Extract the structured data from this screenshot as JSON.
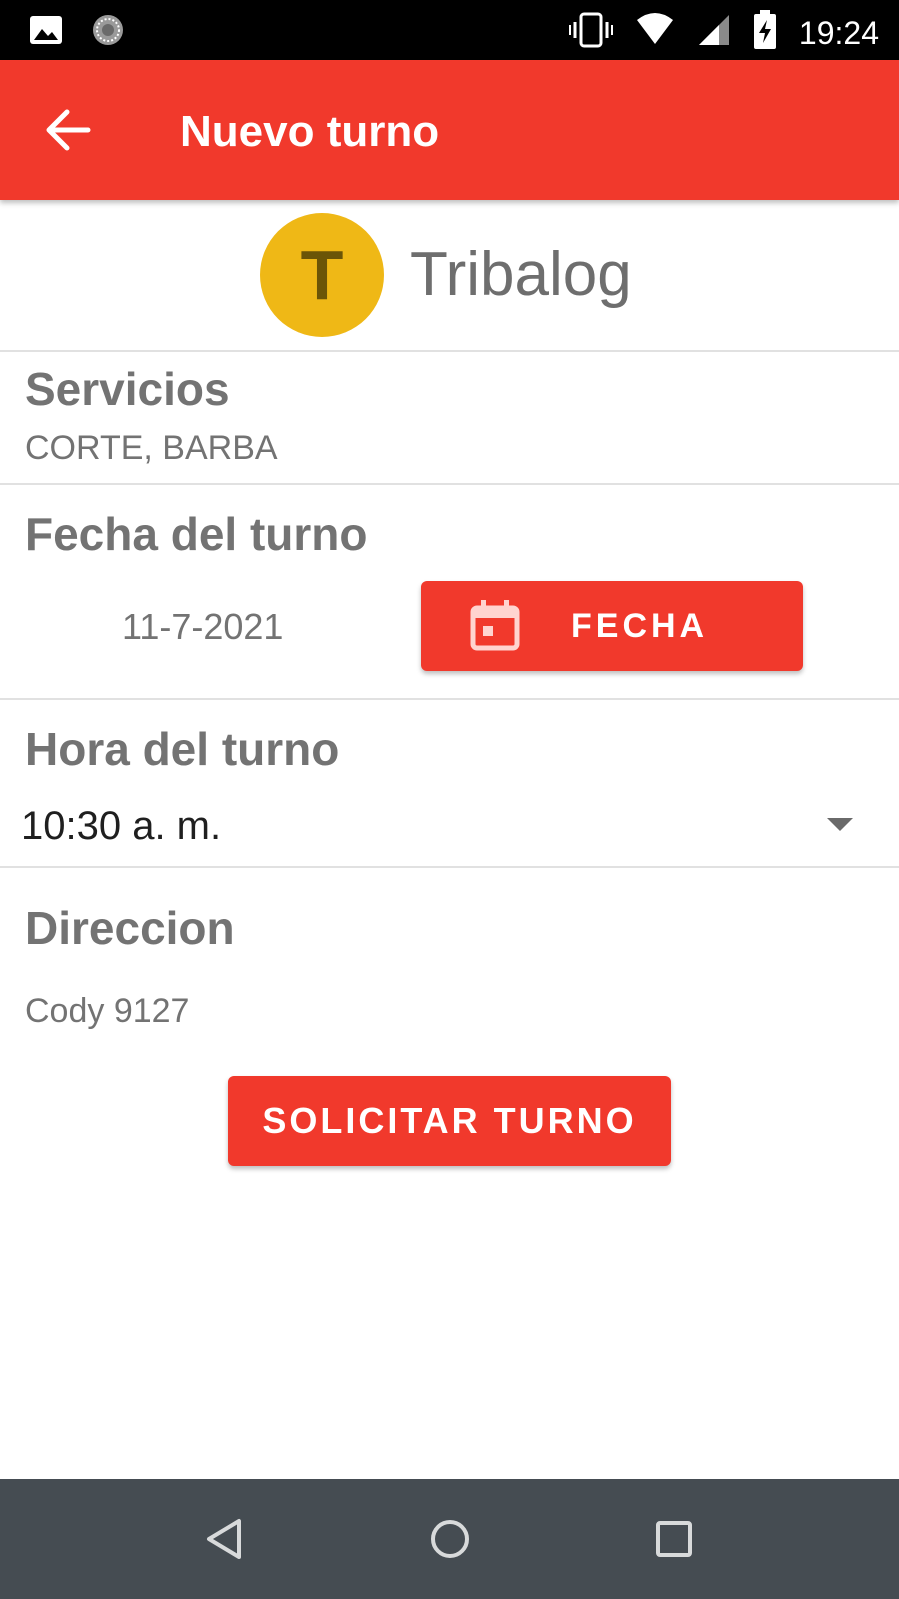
{
  "status_bar": {
    "time": "19:24",
    "icons": [
      "image-icon",
      "sync-icon",
      "vibrate-icon",
      "wifi-icon",
      "signal-icon",
      "battery-charging-icon"
    ]
  },
  "app_bar": {
    "title": "Nuevo turno",
    "back_icon": "arrow-back-icon",
    "color": "#f1392c"
  },
  "brand": {
    "avatar_letter": "T",
    "name": "Tribalog",
    "avatar_color": "#efb816"
  },
  "services": {
    "title": "Servicios",
    "value": "CORTE, BARBA"
  },
  "date": {
    "title": "Fecha del turno",
    "value": "11-7-2021",
    "button_label": "FECHA",
    "button_icon": "calendar-icon"
  },
  "time": {
    "title": "Hora del turno",
    "selected": "10:30 a. m."
  },
  "address": {
    "title": "Direccion",
    "value": "Cody 9127"
  },
  "submit": {
    "label": "SOLICITAR TURNO"
  },
  "nav_bar": {
    "icons": [
      "back-triangle-icon",
      "home-circle-icon",
      "recents-square-icon"
    ]
  }
}
